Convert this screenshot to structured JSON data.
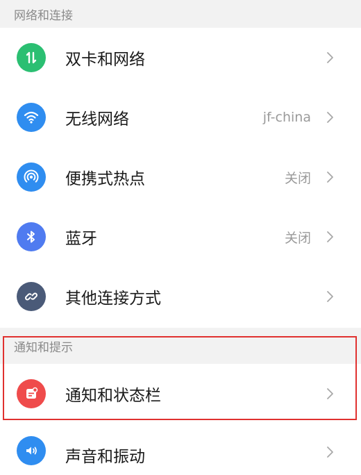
{
  "sections": [
    {
      "header": "网络和连接",
      "items": [
        {
          "label": "双卡和网络",
          "value": "",
          "icon": "dual-sim-icon",
          "color": "#2bbf72"
        },
        {
          "label": "无线网络",
          "value": "jf-china",
          "icon": "wifi-icon",
          "color": "#2f8df0"
        },
        {
          "label": "便携式热点",
          "value": "关闭",
          "icon": "hotspot-icon",
          "color": "#2f8df0"
        },
        {
          "label": "蓝牙",
          "value": "关闭",
          "icon": "bluetooth-icon",
          "color": "#4f7bf0"
        },
        {
          "label": "其他连接方式",
          "value": "",
          "icon": "link-icon",
          "color": "#4a5a78"
        }
      ]
    },
    {
      "header": "通知和提示",
      "items": [
        {
          "label": "通知和状态栏",
          "value": "",
          "icon": "notification-icon",
          "color": "#ef4b4b"
        },
        {
          "label": "声音和振动",
          "value": "",
          "icon": "speaker-icon",
          "color": "#2f8df0"
        }
      ]
    }
  ],
  "highlight_color": "#e0312f"
}
